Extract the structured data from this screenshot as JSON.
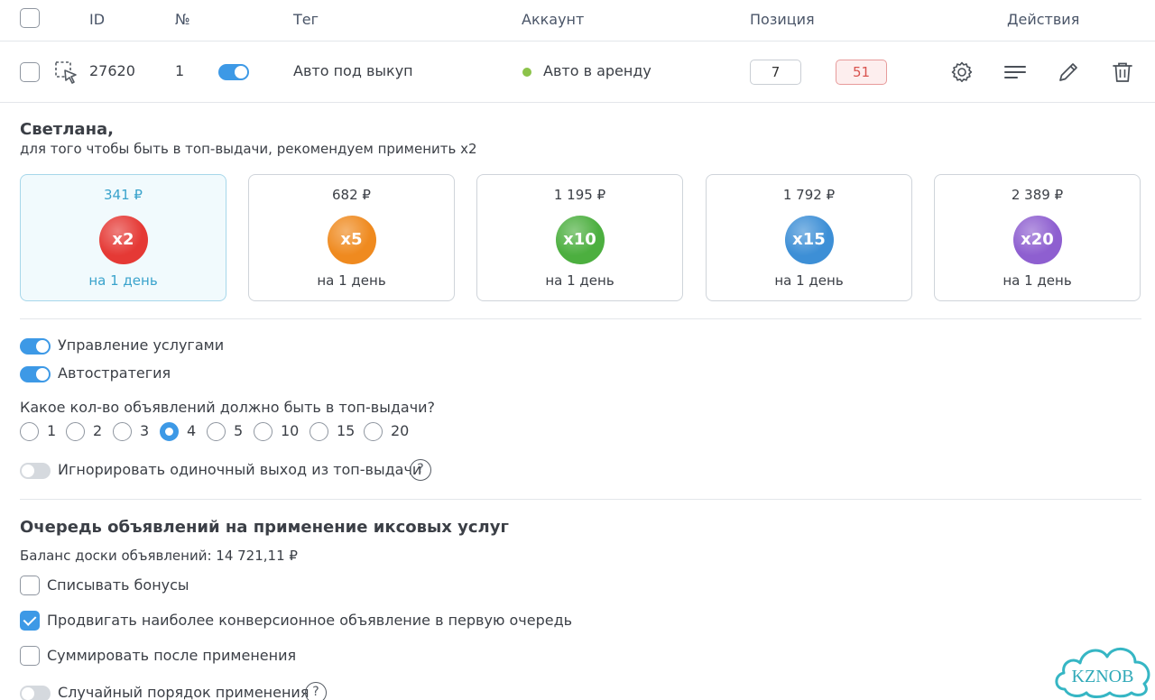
{
  "table": {
    "headers": {
      "id": "ID",
      "num": "№",
      "tag": "Тег",
      "account": "Аккаунт",
      "position": "Позиция",
      "actions": "Действия"
    },
    "row": {
      "id": "27620",
      "num": "1",
      "tag": "Авто под выкуп",
      "account": "Авто в аренду",
      "position_target": "7",
      "position_current": "51",
      "toggle_on": true
    }
  },
  "greeting": {
    "name": "Светлана,",
    "recommendation": "для того чтобы быть в топ-выдачи, рекомендуем применить х2"
  },
  "boosts": [
    {
      "price": "341 ₽",
      "mult": "x2",
      "period": "на 1 день",
      "color": "#e53935"
    },
    {
      "price": "682 ₽",
      "mult": "x5",
      "period": "на 1 день",
      "color": "#ef8a1f"
    },
    {
      "price": "1 195 ₽",
      "mult": "x10",
      "period": "на 1 день",
      "color": "#4caf3f"
    },
    {
      "price": "1 792 ₽",
      "mult": "x15",
      "period": "на 1 день",
      "color": "#3d8fd6"
    },
    {
      "price": "2 389 ₽",
      "mult": "x20",
      "period": "на 1 день",
      "color": "#8e5fd0"
    }
  ],
  "settings": {
    "services_label": "Управление услугами",
    "autostrategy_label": "Автостратегия",
    "top_question": "Какое кол-во объявлений должно быть в топ-выдачи?",
    "top_options": [
      "1",
      "2",
      "3",
      "4",
      "5",
      "10",
      "15",
      "20"
    ],
    "top_selected": "4",
    "ignore_label": "Игнорировать одиночный выход из топ-выдачи",
    "help_glyph": "?"
  },
  "queue": {
    "title": "Очередь объявлений на применение иксовых услуг",
    "balance": "Баланс доски объявлений: 14 721,11 ₽",
    "bonus_label": "Списывать бонусы",
    "conversion_label": "Продвигать наиболее конверсионное объявление в первую очередь",
    "sum_label": "Суммировать после применения",
    "random_label": "Случайный порядок применения"
  },
  "logo": {
    "text": "KZNOB"
  },
  "colors": {
    "accent": "#3d99e6",
    "status_ok": "#8cc34a",
    "danger": "#d9534f"
  }
}
